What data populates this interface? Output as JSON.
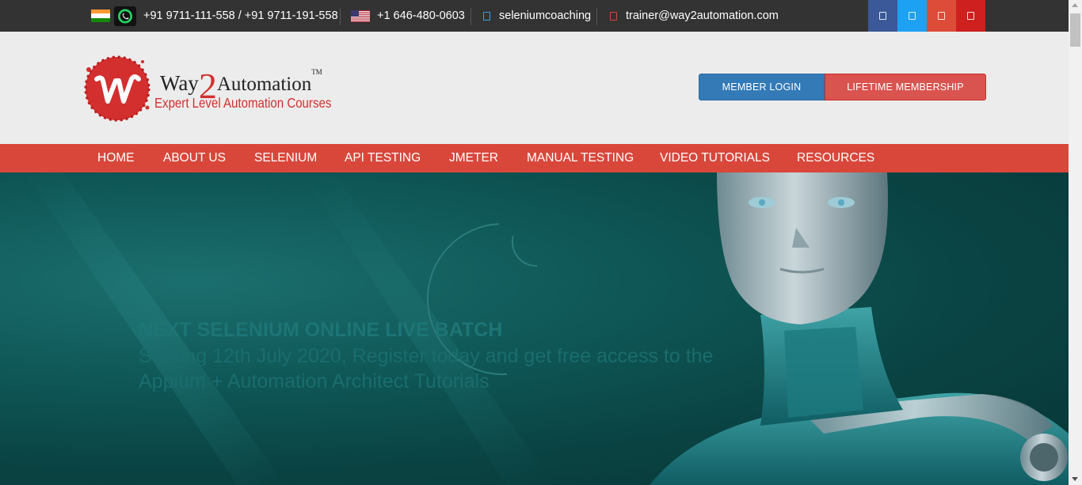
{
  "topbar": {
    "india_phone": "+91 9711-111-558 / +91 9711-191-558",
    "us_phone": "+1 646-480-0603",
    "skype": "seleniumcoaching",
    "email": "trainer@way2automation.com",
    "icons": [
      "india-flag-icon",
      "whatsapp-icon",
      "us-flag-icon",
      "skype-icon",
      "mail-icon"
    ],
    "social": [
      {
        "name": "facebook-icon",
        "color": "#3b5998"
      },
      {
        "name": "twitter-icon",
        "color": "#1da1f2"
      },
      {
        "name": "google-plus-icon",
        "color": "#dd4b39"
      },
      {
        "name": "youtube-icon",
        "color": "#cd201f"
      }
    ]
  },
  "logo": {
    "brand_prefix": "Way",
    "brand_digit": "2",
    "brand_suffix": "Automation",
    "trademark": "TM",
    "tagline": "Expert Level Automation Courses"
  },
  "header_buttons": {
    "member_login": "MEMBER LOGIN",
    "lifetime_membership": "LIFETIME MEMBERSHIP"
  },
  "nav": [
    "HOME",
    "ABOUT US",
    "SELENIUM",
    "API TESTING",
    "JMETER",
    "MANUAL TESTING",
    "VIDEO TUTORIALS",
    "RESOURCES"
  ],
  "hero": {
    "heading": "NEXT SELENIUM ONLINE LIVE BATCH",
    "line1": "Starting 12th July 2020, Register today and get free access to the",
    "line2": "Appium + Automation Architect Tutorials"
  },
  "colors": {
    "topbar": "#333333",
    "nav": "#d9473b",
    "login_button": "#337ab7",
    "membership_button": "#d9534f",
    "hero": "#0f5757"
  }
}
